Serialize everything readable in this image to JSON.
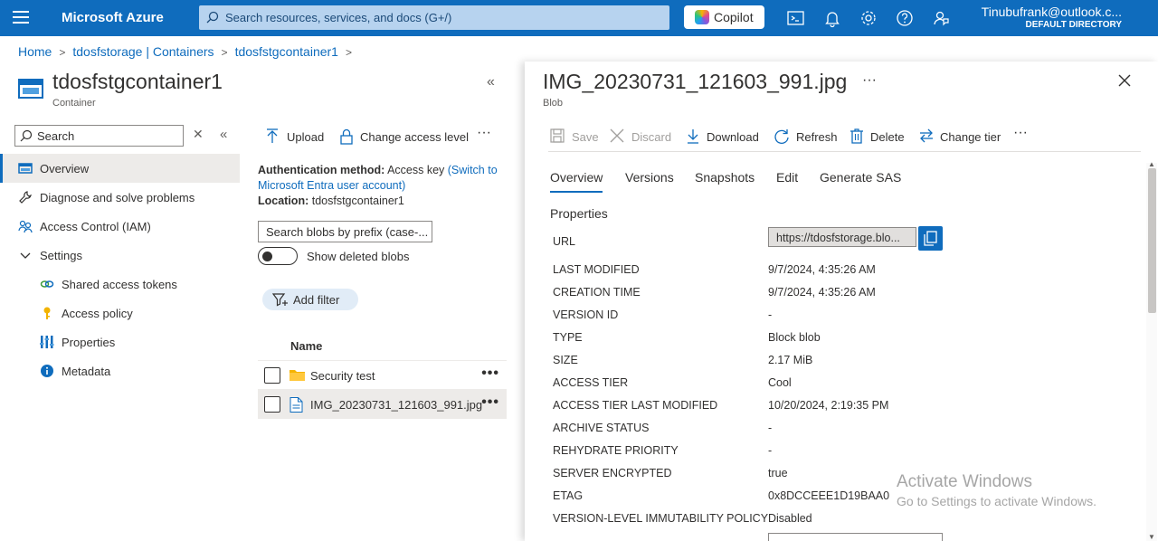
{
  "topbar": {
    "brand": "Microsoft Azure",
    "search_placeholder": "Search resources, services, and docs (G+/)",
    "copilot_label": "Copilot",
    "user_name": "Tinubufrank@outlook.c...",
    "user_directory": "DEFAULT DIRECTORY"
  },
  "breadcrumb": [
    "Home",
    "tdosfstorage | Containers",
    "tdosfstgcontainer1"
  ],
  "resource": {
    "title": "tdosfstgcontainer1",
    "subtitle": "Container"
  },
  "nav": {
    "search_placeholder": "Search",
    "items": [
      {
        "label": "Overview",
        "icon": "overview-icon",
        "active": true
      },
      {
        "label": "Diagnose and solve problems",
        "icon": "wrench-icon"
      },
      {
        "label": "Access Control (IAM)",
        "icon": "people-icon"
      },
      {
        "label": "Settings",
        "icon": "chevron-down-icon"
      },
      {
        "label": "Shared access tokens",
        "icon": "link-icon"
      },
      {
        "label": "Access policy",
        "icon": "key-icon"
      },
      {
        "label": "Properties",
        "icon": "properties-icon"
      },
      {
        "label": "Metadata",
        "icon": "info-icon"
      }
    ]
  },
  "container_toolbar": {
    "upload": "Upload",
    "change_access": "Change access level",
    "more": "···"
  },
  "auth": {
    "method_label": "Authentication method:",
    "method_value": "Access key",
    "switch_link": "(Switch to Microsoft Entra user account)",
    "location_label": "Location:",
    "location_value": "tdosfstgcontainer1"
  },
  "blobs": {
    "search_placeholder": "Search blobs by prefix (case-...",
    "show_deleted": "Show deleted blobs",
    "add_filter": "Add filter",
    "column_name": "Name",
    "rows": [
      {
        "name": "Security test",
        "type": "folder"
      },
      {
        "name": "IMG_20230731_121603_991.jpg",
        "type": "file"
      }
    ],
    "row_more": "•••"
  },
  "blade": {
    "title": "IMG_20230731_121603_991.jpg",
    "dots": "···",
    "subtitle": "Blob",
    "toolbar": {
      "save": "Save",
      "discard": "Discard",
      "download": "Download",
      "refresh": "Refresh",
      "delete": "Delete",
      "change_tier": "Change tier",
      "more": "···"
    },
    "tabs": [
      "Overview",
      "Versions",
      "Snapshots",
      "Edit",
      "Generate SAS"
    ],
    "properties_heading": "Properties",
    "url_label": "URL",
    "url_value": "https://tdosfstorage.blo...",
    "properties": [
      {
        "key": "LAST MODIFIED",
        "value": "9/7/2024, 4:35:26 AM"
      },
      {
        "key": "CREATION TIME",
        "value": "9/7/2024, 4:35:26 AM"
      },
      {
        "key": "VERSION ID",
        "value": "-"
      },
      {
        "key": "TYPE",
        "value": "Block blob"
      },
      {
        "key": "SIZE",
        "value": "2.17 MiB"
      },
      {
        "key": "ACCESS TIER",
        "value": "Cool"
      },
      {
        "key": "ACCESS TIER LAST MODIFIED",
        "value": "10/20/2024, 2:19:35 PM"
      },
      {
        "key": "ARCHIVE STATUS",
        "value": "-"
      },
      {
        "key": "REHYDRATE PRIORITY",
        "value": "-"
      },
      {
        "key": "SERVER ENCRYPTED",
        "value": "true"
      },
      {
        "key": "ETAG",
        "value": "0x8DCCEEE1D19BAA0"
      },
      {
        "key": "VERSION-LEVEL IMMUTABILITY POLICY",
        "value": "Disabled"
      }
    ]
  },
  "watermark": {
    "line1": "Activate Windows",
    "line2": "Go to Settings to activate Windows."
  },
  "colors": {
    "brand": "#0f6cbd",
    "active_bg": "#edebe9"
  }
}
